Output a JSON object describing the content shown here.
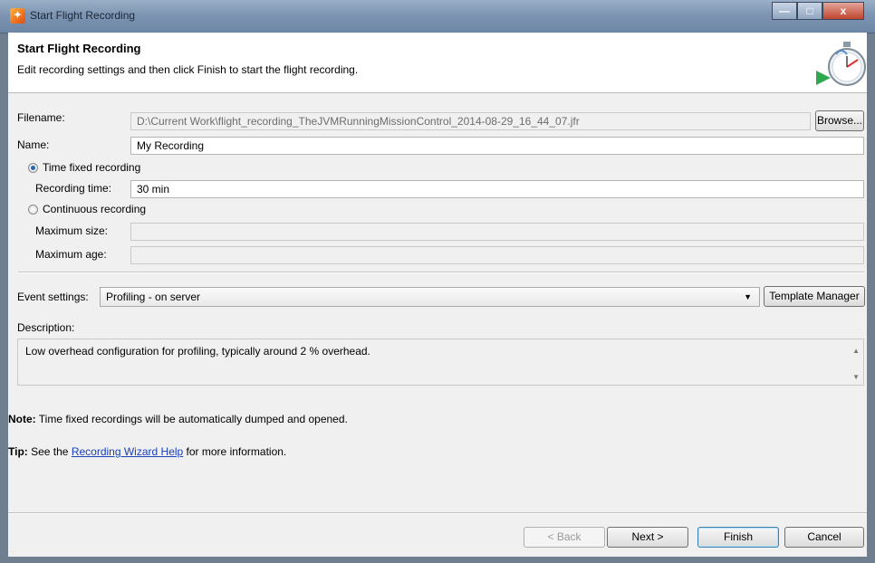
{
  "window": {
    "title": "Start Flight Recording",
    "minimize": "—",
    "maximize": "□",
    "close": "x"
  },
  "header": {
    "title": "Start Flight Recording",
    "description": "Edit recording settings and then click Finish to start the flight recording."
  },
  "form": {
    "filename_label": "Filename:",
    "filename_value": "D:\\Current Work\\flight_recording_TheJVMRunningMissionControl_2014-08-29_16_44_07.jfr",
    "browse_label": "Browse...",
    "name_label": "Name:",
    "name_value": "My Recording",
    "time_fixed_label": "Time fixed recording",
    "recording_time_label": "Recording time:",
    "recording_time_value": "30 min",
    "continuous_label": "Continuous recording",
    "max_size_label": "Maximum size:",
    "max_size_value": "",
    "max_age_label": "Maximum age:",
    "max_age_value": "",
    "event_settings_label": "Event settings:",
    "event_settings_value": "Profiling - on server",
    "template_manager_label": "Template Manager",
    "description_label": "Description:",
    "description_value": "Low overhead configuration for profiling, typically around 2 % overhead."
  },
  "notes": {
    "note_bold": "Note:",
    "note_text": " Time fixed recordings will be automatically dumped and opened.",
    "tip_bold": "Tip:",
    "tip_pre": " See the ",
    "tip_link": "Recording Wizard Help",
    "tip_post": " for more information."
  },
  "footer": {
    "back_label": "< Back",
    "next_label": "Next >",
    "finish_label": "Finish",
    "cancel_label": "Cancel"
  }
}
